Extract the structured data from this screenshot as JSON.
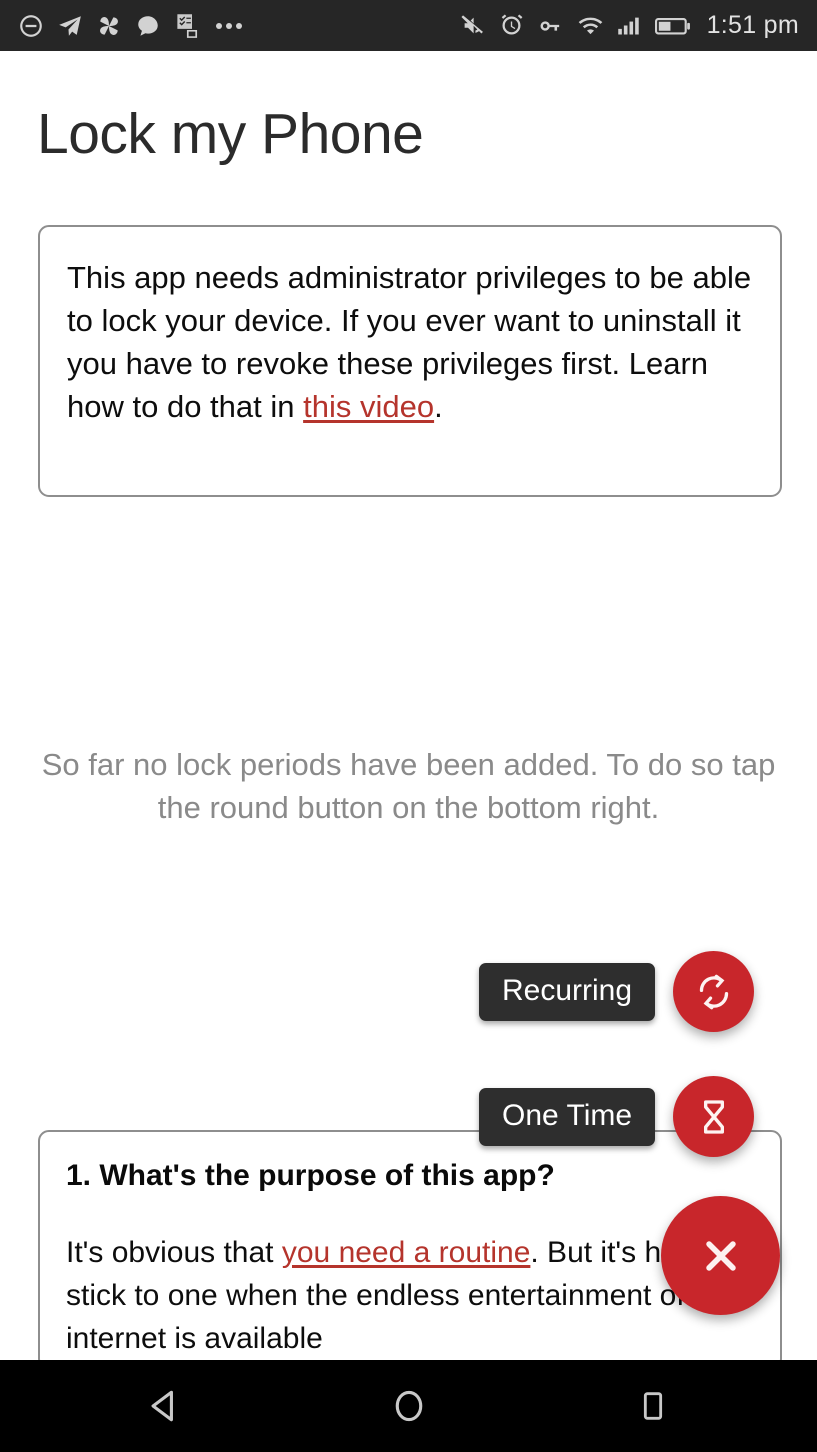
{
  "status_bar": {
    "background": "#262626",
    "left_icons": [
      {
        "name": "do-not-disturb-icon"
      },
      {
        "name": "telegram-send-icon"
      },
      {
        "name": "pinwheel-icon"
      },
      {
        "name": "chat-bubble-icon"
      },
      {
        "name": "checklist-copy-icon"
      },
      {
        "name": "more-notifications-icon"
      }
    ],
    "right_icons": [
      {
        "name": "volume-mute-icon"
      },
      {
        "name": "alarm-clock-icon"
      },
      {
        "name": "vpn-key-icon"
      },
      {
        "name": "wifi-icon"
      },
      {
        "name": "cellular-signal-icon"
      },
      {
        "name": "battery-icon"
      }
    ],
    "time": "1:51 pm"
  },
  "header": {
    "title": "Lock my Phone"
  },
  "notice_card": {
    "text_before_link": "This app needs administrator privileges to be able to lock your device. If you ever want to uninstall it you have to revoke these privileges first. Learn how to do that in ",
    "link_label": "this video",
    "text_after_link": "."
  },
  "empty_state": {
    "message": "So far no lock periods have been added. To do so tap the round button on the bottom right."
  },
  "speed_dial": {
    "accent_color": "#c8262b",
    "label_background": "#2e2e2e",
    "actions": [
      {
        "label": "Recurring",
        "icon": "repeat-icon"
      },
      {
        "label": "One Time",
        "icon": "hourglass-icon"
      }
    ],
    "main_button": {
      "icon": "close-icon",
      "label": "Close speed dial"
    }
  },
  "faq_card": {
    "question": "1. What's the purpose of this app?",
    "answer_before_link": "It's obvious that ",
    "answer_link": "you need a routine",
    "answer_after_link": ". But it's hard to stick to one when the endless entertainment of the internet is available"
  },
  "nav_bar": {
    "buttons": [
      {
        "name": "back-button"
      },
      {
        "name": "home-button"
      },
      {
        "name": "recents-button"
      }
    ]
  },
  "colors": {
    "accent_red": "#c8262b",
    "link_red": "#b5342c",
    "card_border": "#8e8e8e",
    "muted_text": "#8a8a8a",
    "status_bar": "#262626",
    "nav_bar": "#000000"
  }
}
